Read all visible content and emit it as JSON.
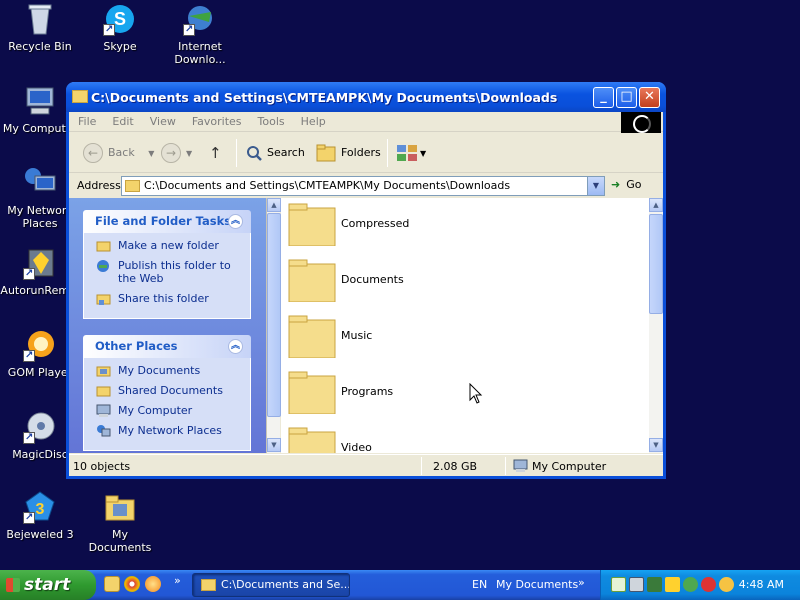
{
  "desktop": {
    "icons": [
      {
        "label": "Recycle Bin",
        "icon": "recycle-bin-icon"
      },
      {
        "label": "Skype",
        "icon": "skype-icon"
      },
      {
        "label": "Internet Downlo...",
        "icon": "internet-download-manager-icon"
      },
      {
        "label": "My Computer",
        "icon": "my-computer-icon"
      },
      {
        "label": "My Network Places",
        "icon": "network-places-icon"
      },
      {
        "label": "AutorunRem...",
        "icon": "autorun-remover-icon"
      },
      {
        "label": "GOM Player",
        "icon": "gom-player-icon"
      },
      {
        "label": "MagicDisc",
        "icon": "magicdisc-icon"
      },
      {
        "label": "Bejeweled 3",
        "icon": "bejeweled-icon"
      },
      {
        "label": "My Documents",
        "icon": "my-documents-icon"
      }
    ]
  },
  "window": {
    "title": "C:\\Documents and Settings\\CMTEAMPK\\My Documents\\Downloads",
    "controls": {
      "minimize": "_",
      "maximize": "□",
      "close": "✕"
    },
    "menu": [
      "File",
      "Edit",
      "View",
      "Favorites",
      "Tools",
      "Help"
    ],
    "toolbar": {
      "back": "Back",
      "search": "Search",
      "folders": "Folders"
    },
    "address": {
      "label": "Address",
      "value": "C:\\Documents and Settings\\CMTEAMPK\\My Documents\\Downloads",
      "go": "Go"
    },
    "tasks_panel": {
      "title": "File and Folder Tasks",
      "items": [
        {
          "label": "Make a new folder",
          "icon": "new-folder-icon"
        },
        {
          "label": "Publish this folder to the Web",
          "icon": "publish-web-icon"
        },
        {
          "label": "Share this folder",
          "icon": "share-folder-icon"
        }
      ]
    },
    "places_panel": {
      "title": "Other Places",
      "items": [
        {
          "label": "My Documents",
          "icon": "my-documents-icon"
        },
        {
          "label": "Shared Documents",
          "icon": "shared-documents-icon"
        },
        {
          "label": "My Computer",
          "icon": "my-computer-icon"
        },
        {
          "label": "My Network Places",
          "icon": "network-places-icon"
        }
      ]
    },
    "files": [
      {
        "name": "Compressed",
        "icon": "folder-icon"
      },
      {
        "name": "Documents",
        "icon": "folder-icon"
      },
      {
        "name": "Music",
        "icon": "folder-icon"
      },
      {
        "name": "Programs",
        "icon": "folder-icon"
      },
      {
        "name": "Video",
        "icon": "folder-icon"
      }
    ],
    "status": {
      "objects": "10 objects",
      "size": "2.08 GB",
      "location": "My Computer"
    }
  },
  "taskbar": {
    "start": "start",
    "active_task": "C:\\Documents and Se...",
    "language": "EN",
    "toolbar_label": "My Documents",
    "clock": "4:48 AM"
  },
  "colors": {
    "desktop": "#0b0b4a",
    "titlebar": "#0a53e0",
    "start": "#2f9a2f",
    "tray": "#0f8be0"
  }
}
